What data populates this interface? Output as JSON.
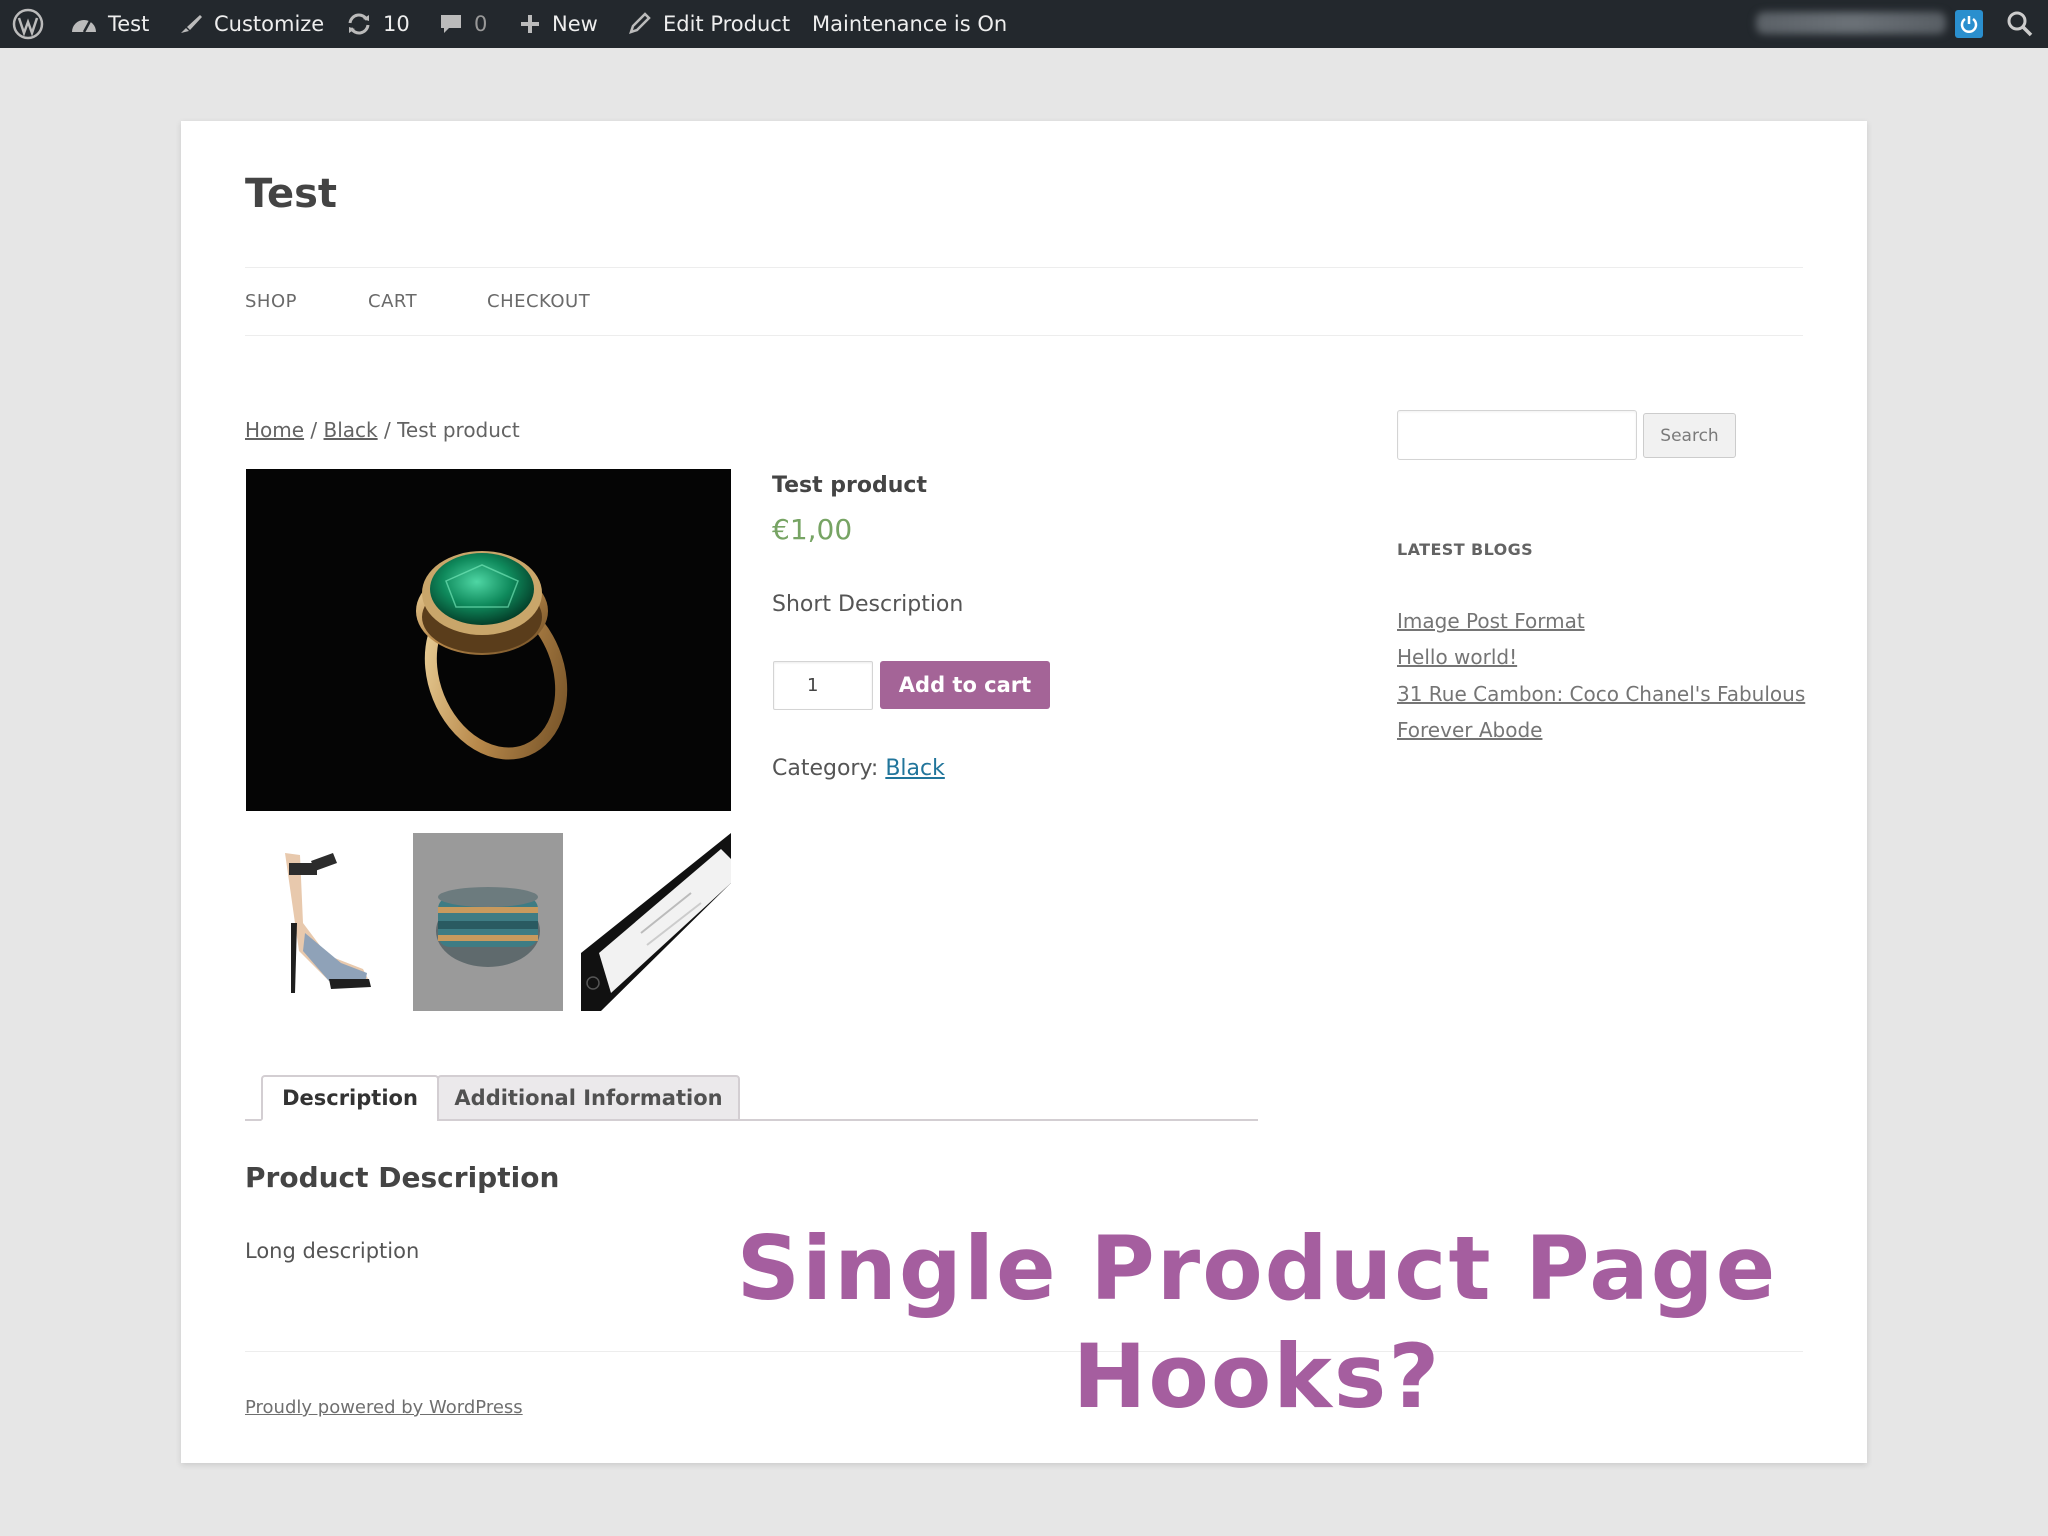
{
  "admin_bar": {
    "site_name": "Test",
    "customize_label": "Customize",
    "updates_count": "10",
    "comments_count": "0",
    "new_label": "New",
    "edit_label": "Edit Product",
    "maintenance_label": "Maintenance is On"
  },
  "site": {
    "title": "Test",
    "nav": [
      "SHOP",
      "CART",
      "CHECKOUT"
    ]
  },
  "breadcrumb": {
    "home": "Home",
    "separator": " / ",
    "category": "Black",
    "current": "Test product"
  },
  "product": {
    "title": "Test product",
    "price": "€1,00",
    "short_description": "Short Description",
    "quantity": "1",
    "add_to_cart_label": "Add to cart",
    "category_label": "Category: ",
    "category_value": "Black",
    "price_color": "#77a464",
    "button_color": "#a46497"
  },
  "tabs": [
    "Description",
    "Additional Information"
  ],
  "description": {
    "heading": "Product Description",
    "body": "Long description"
  },
  "sidebar": {
    "search_button": "Search",
    "widget_title": "LATEST BLOGS",
    "blogs": [
      "Image Post Format",
      "Hello world!",
      "31 Rue Cambon: Coco Chanel's Fabulous",
      "Forever Abode"
    ]
  },
  "footer": {
    "powered_by": "Proudly powered by WordPress"
  },
  "overlay": {
    "line1": "Single Product Page",
    "line2": "Hooks?",
    "color": "#a55e9f"
  }
}
